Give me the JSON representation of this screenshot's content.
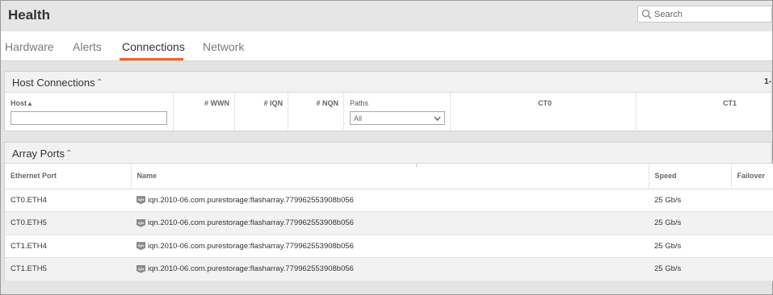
{
  "header": {
    "title": "Health",
    "search_placeholder": "Search"
  },
  "tabs": [
    {
      "label": "Hardware",
      "active": false
    },
    {
      "label": "Alerts",
      "active": false
    },
    {
      "label": "Connections",
      "active": true
    },
    {
      "label": "Network",
      "active": false
    }
  ],
  "host_connections": {
    "title": "Host Connections",
    "pager": "1-",
    "columns": {
      "host": "Host",
      "wwn": "# WWN",
      "iqn": "# IQN",
      "nqn": "# NQN",
      "paths": "Paths",
      "ct0": "CT0",
      "ct1": "CT1"
    },
    "host_filter_value": "",
    "paths_filter_value": "All"
  },
  "array_ports": {
    "title": "Array Ports",
    "columns": [
      "Ethernet Port",
      "Name",
      "Speed",
      "Failover"
    ],
    "rows": [
      {
        "port": "CT0.ETH4",
        "name": "iqn.2010-06.com.purestorage:flasharray.779962553908b056",
        "speed": "25 Gb/s",
        "failover": ""
      },
      {
        "port": "CT0.ETH5",
        "name": "iqn.2010-06.com.purestorage:flasharray.779962553908b056",
        "speed": "25 Gb/s",
        "failover": ""
      },
      {
        "port": "CT1.ETH4",
        "name": "iqn.2010-06.com.purestorage:flasharray.779962553908b056",
        "speed": "25 Gb/s",
        "failover": ""
      },
      {
        "port": "CT1.ETH5",
        "name": "iqn.2010-06.com.purestorage:flasharray.779962553908b056",
        "speed": "25 Gb/s",
        "failover": ""
      }
    ],
    "badge_text": "IQN"
  },
  "colors": {
    "accent": "#f26322"
  }
}
